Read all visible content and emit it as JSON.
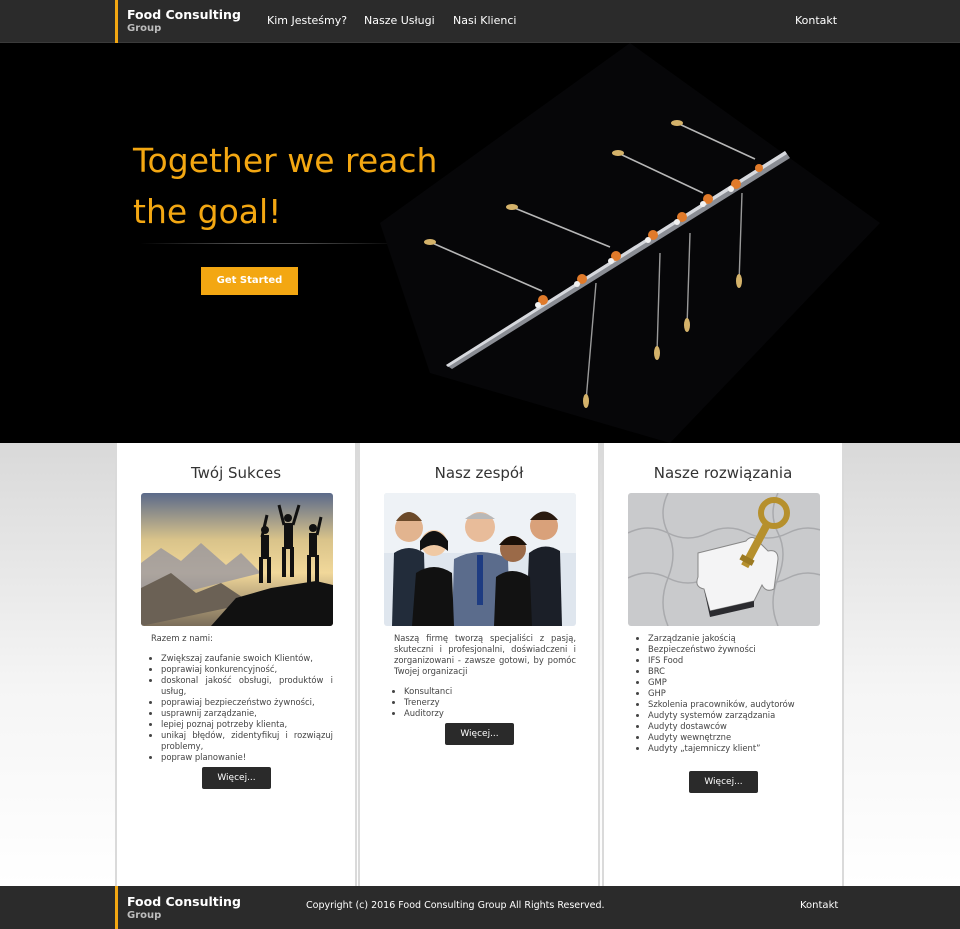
{
  "nav": {
    "brand_line1": "Food Consulting",
    "brand_line2": "Group",
    "links": [
      "Kim Jesteśmy?",
      "Nasze Usługi",
      "Nasi Klienci"
    ],
    "contact": "Kontakt"
  },
  "hero": {
    "title_line1": "Together we reach",
    "title_line2": "the goal!",
    "cta": "Get Started"
  },
  "cards": [
    {
      "title": "Twój Sukces",
      "intro": "Razem z nami:",
      "items": [
        "Zwiększaj zaufanie swoich Klientów,",
        "poprawiaj konkurencyjność,",
        "doskonal jakość obsługi, produktów i usług,",
        "poprawiaj bezpieczeństwo żywności,",
        "usprawnij zarządzanie,",
        "lepiej poznaj potrzeby klienta,",
        "unikaj błędów, zidentyfikuj i rozwiązuj problemy,",
        "popraw planowanie!"
      ],
      "button": "Więcej..."
    },
    {
      "title": "Nasz zespół",
      "intro": "Naszą firmę tworzą specjaliści z pasją, skuteczni i profesjonalni, doświadczeni i zorganizowani - zawsze gotowi, by pomóc Twojej organizacji",
      "items": [
        "Konsultanci",
        "Trenerzy",
        "Auditorzy"
      ],
      "button": "Więcej..."
    },
    {
      "title": "Nasze rozwiązania",
      "intro": "",
      "items": [
        "Zarządzanie jakością",
        "Bezpieczeństwo żywności",
        "IFS Food",
        "BRC",
        "GMP",
        "GHP",
        "Szkolenia pracowników, audytorów",
        "Audyty systemów zarządzania",
        "Audyty dostawców",
        "Audyty wewnętrzne",
        "Audyty „tajemniczy klient”"
      ],
      "button": "Więcej..."
    }
  ],
  "footer": {
    "brand_line1": "Food Consulting",
    "brand_line2": "Group",
    "copyright": "Copyright (c) 2016 Food Consulting Group All Rights Reserved.",
    "contact": "Kontakt"
  },
  "colors": {
    "accent": "#f3a712",
    "nav_bg": "#2b2b2b",
    "button_dark": "#2a2a2a"
  }
}
